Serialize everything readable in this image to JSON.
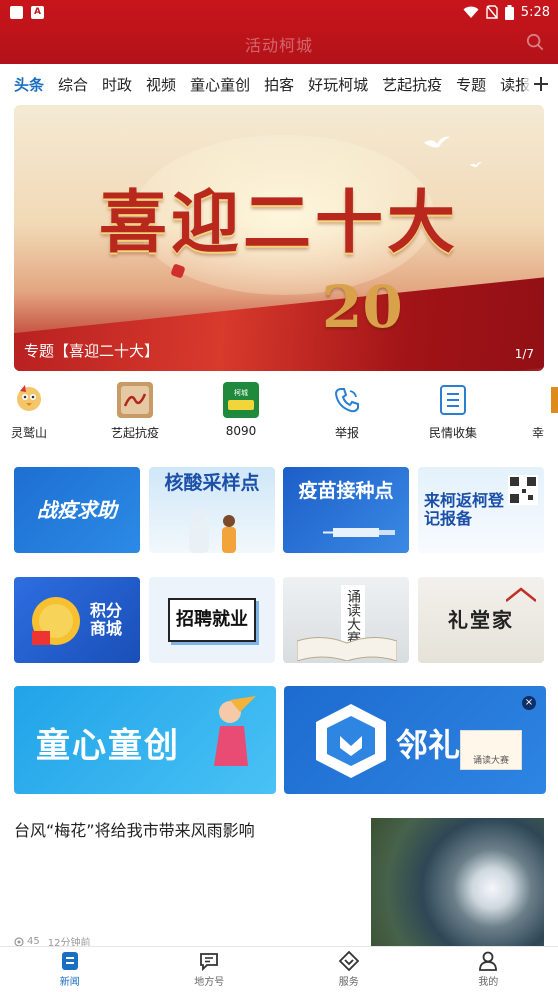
{
  "status_bar": {
    "time": "5:28"
  },
  "header": {
    "title": "活动柯城"
  },
  "tabs": [
    "头条",
    "综合",
    "时政",
    "视频",
    "童心童创",
    "拍客",
    "好玩柯城",
    "艺起抗疫",
    "专题",
    "读报"
  ],
  "banner": {
    "caption": "专题【喜迎二十大】",
    "pager": "1/7",
    "headline_art": "喜迎二十大",
    "number_art": "20"
  },
  "shortcuts": [
    {
      "label": "灵鹫山",
      "icon": "mascot-icon"
    },
    {
      "label": "艺起抗疫",
      "icon": "art-icon"
    },
    {
      "label": "8090",
      "icon": "8090-league-icon",
      "badge": "柯城"
    },
    {
      "label": "举报",
      "icon": "phone-icon"
    },
    {
      "label": "民情收集",
      "icon": "list-icon"
    },
    {
      "label": "幸",
      "icon": "house-icon"
    }
  ],
  "tiles_row1": [
    "战疫求助",
    "核酸采样点",
    "疫苗接种点",
    "来柯返柯登记报备"
  ],
  "tiles_row2": [
    "积分商城",
    "招聘就业",
    "诵读大赛",
    "礼堂家"
  ],
  "tile_decor": {
    "reading_vertical": "诵读大赛"
  },
  "wide_banners": [
    "童心童创",
    "邻礼"
  ],
  "wide_decor": {
    "reading_caption": "诵读大赛"
  },
  "news": {
    "headline": "台风“梅花”将给我市带来风雨影响",
    "views": "45",
    "time": "12分钟前"
  },
  "bottom_nav": [
    "新闻",
    "地方号",
    "服务",
    "我的"
  ],
  "colors": {
    "header_red": "#c8151b",
    "accent_blue": "#1a6fc2"
  }
}
